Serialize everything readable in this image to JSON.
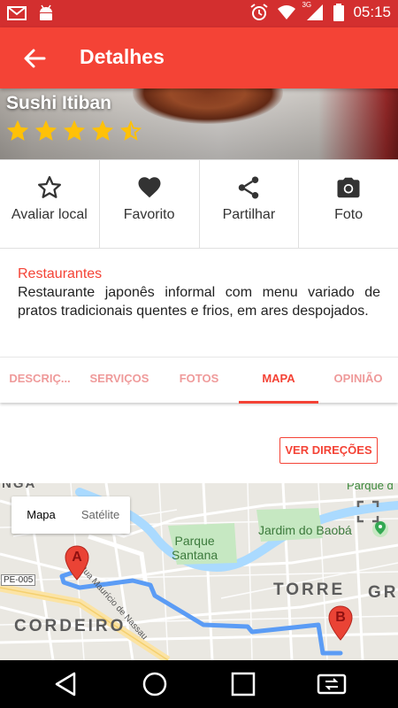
{
  "status_bar": {
    "time": "05:15",
    "network": "3G",
    "icons": [
      "gmail-icon",
      "android-icon",
      "alarm-icon",
      "wifi-icon",
      "cell-signal-icon",
      "battery-icon"
    ]
  },
  "app_bar": {
    "title": "Detalhes",
    "back_icon": "arrow-back-icon"
  },
  "place": {
    "name": "Sushi Itiban",
    "rating": 4.5,
    "rating_max": 5,
    "star_color": "#ffc107"
  },
  "actions": [
    {
      "label": "Avaliar local",
      "icon": "star-outline-icon"
    },
    {
      "label": "Favorito",
      "icon": "heart-icon"
    },
    {
      "label": "Partilhar",
      "icon": "share-icon"
    },
    {
      "label": "Foto",
      "icon": "camera-icon"
    }
  ],
  "description": {
    "category": "Restaurantes",
    "text": "Restaurante japonês informal com menu variado de pratos tradicionais quentes e frios, em ares despojados."
  },
  "tabs": [
    {
      "label": "DESCRIÇ...",
      "active": false
    },
    {
      "label": "SERVIÇOS",
      "active": false
    },
    {
      "label": "FOTOS",
      "active": false
    },
    {
      "label": "MAPA",
      "active": true
    },
    {
      "label": "OPINIÃO",
      "active": false
    }
  ],
  "directions_label": "VER DIREÇÕES",
  "map": {
    "toggle": {
      "map": "Mapa",
      "satellite": "Satélite",
      "selected": "Mapa"
    },
    "labels": {
      "park": "Parque\nSantana",
      "garden": "Jardim do Baobá",
      "district_torre": "TORRE",
      "district_gr": "GR",
      "district_cordeiro": "CORDEIRO",
      "road_shield": "PE-005",
      "street": "Rua Maurício de Nassau",
      "top_left": "NGA",
      "top_right": "Parque d"
    },
    "markers": [
      {
        "label": "A"
      },
      {
        "label": "B"
      }
    ],
    "route_color": "#5b9cf5",
    "marker_color": "#ea4335"
  },
  "colors": {
    "primary": "#f44336",
    "primary_dark": "#d32f2f",
    "tab_inactive": "#ef9a9a"
  },
  "nav_bar": {
    "icons": [
      "back-triangle-icon",
      "home-circle-icon",
      "recents-square-icon",
      "rotate-screen-icon"
    ]
  }
}
